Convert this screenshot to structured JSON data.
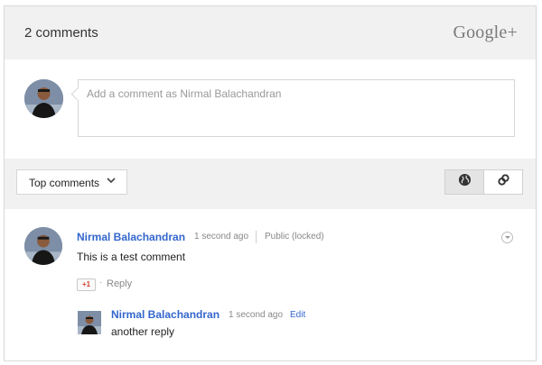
{
  "header": {
    "comment_count": "2 comments",
    "brand": "Google+"
  },
  "compose": {
    "placeholder": "Add a comment as Nirmal Balachandran"
  },
  "toolbar": {
    "sort_label": "Top comments",
    "sort_icon": "chevron-down-icon",
    "view_buttons": [
      {
        "icon": "globe-icon",
        "active": true
      },
      {
        "icon": "link-icon",
        "active": false
      }
    ]
  },
  "comments": [
    {
      "author": "Nirmal Balachandran",
      "time": "1 second ago",
      "visibility": "Public (locked)",
      "text": "This is a test comment",
      "plus_one": "+1",
      "reply_label": "Reply",
      "replies": [
        {
          "author": "Nirmal Balachandran",
          "time": "1 second ago",
          "edit_label": "Edit",
          "text": "another reply"
        }
      ]
    }
  ],
  "colors": {
    "accent": "#3366cc",
    "header_bg": "#f1f1f1",
    "plus_one": "#d9432f"
  }
}
